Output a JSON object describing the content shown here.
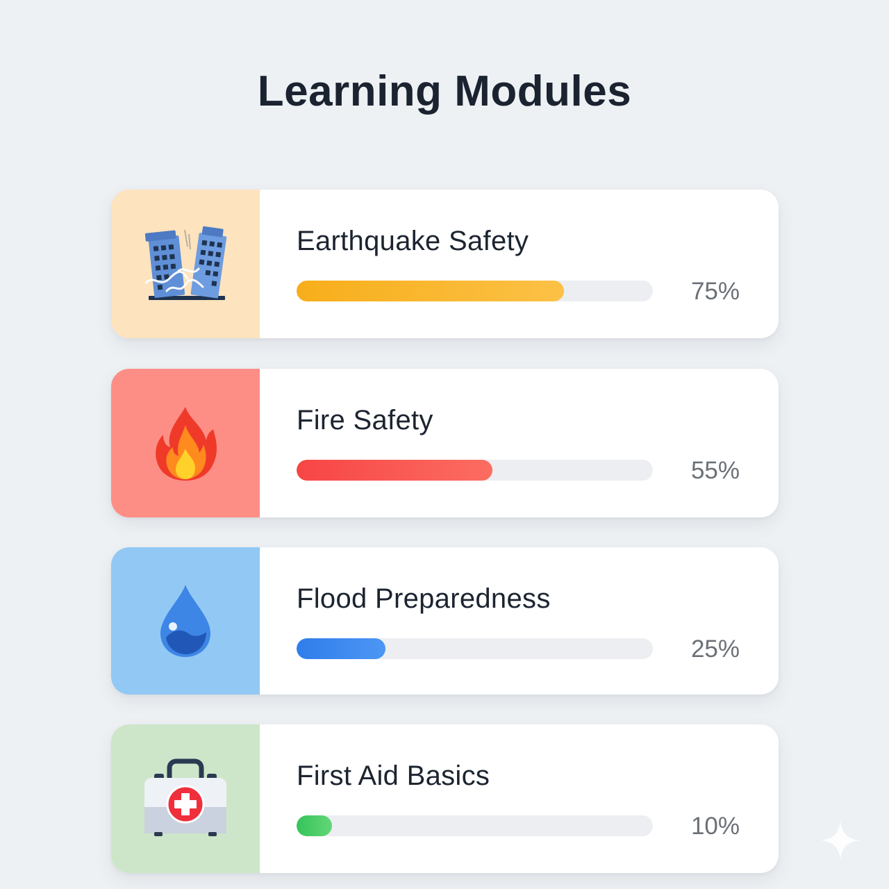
{
  "page": {
    "title": "Learning Modules"
  },
  "modules": [
    {
      "title": "Earthquake Safety",
      "progress": 0.75,
      "progress_label": "75%",
      "icon": "earthquake-buildings-icon",
      "panel_color": "#fde3be",
      "fill_from": "#f7ae1b",
      "fill_to": "#fcc146"
    },
    {
      "title": "Fire Safety",
      "progress": 0.55,
      "progress_label": "55%",
      "icon": "flame-icon",
      "panel_color": "#fc8e86",
      "fill_from": "#f74545",
      "fill_to": "#fc6d61"
    },
    {
      "title": "Flood Preparedness",
      "progress": 0.25,
      "progress_label": "25%",
      "icon": "water-drop-icon",
      "panel_color": "#92c8f4",
      "fill_from": "#2f7deb",
      "fill_to": "#4c96f3"
    },
    {
      "title": "First Aid Basics",
      "progress": 0.1,
      "progress_label": "10%",
      "icon": "first-aid-kit-icon",
      "panel_color": "#cde6c9",
      "fill_from": "#36c35a",
      "fill_to": "#62d777"
    }
  ]
}
